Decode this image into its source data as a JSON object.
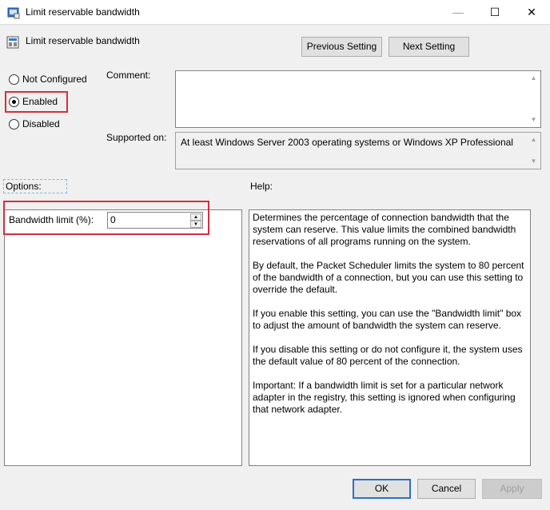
{
  "window": {
    "title": "Limit reservable bandwidth",
    "minimize_glyph": "—",
    "maximize_glyph": "☐",
    "close_glyph": "✕"
  },
  "header": {
    "setting_name": "Limit reservable bandwidth",
    "previous_label": "Previous Setting",
    "next_label": "Next Setting"
  },
  "state": {
    "not_configured_label": "Not Configured",
    "enabled_label": "Enabled",
    "disabled_label": "Disabled",
    "selected": "enabled"
  },
  "comment": {
    "label": "Comment:",
    "value": ""
  },
  "supported": {
    "label": "Supported on:",
    "value": "At least Windows Server 2003 operating systems or Windows XP Professional"
  },
  "options": {
    "label": "Options:",
    "bandwidth_label": "Bandwidth limit (%):",
    "bandwidth_value": "0"
  },
  "help": {
    "label": "Help:",
    "paragraphs": [
      "Determines the percentage of connection bandwidth that the system can reserve. This value limits the combined bandwidth reservations of all programs running on the system.",
      "By default, the Packet Scheduler limits the system to 80 percent of the bandwidth of a connection, but you can use this setting to override the default.",
      "If you enable this setting, you can use the \"Bandwidth limit\" box to adjust the amount of bandwidth the system can reserve.",
      "If you disable this setting or do not configure it, the system uses the default value of 80 percent of the connection.",
      "Important: If a bandwidth limit is set for a particular network adapter in the registry, this setting is ignored when configuring that network adapter."
    ]
  },
  "footer": {
    "ok_label": "OK",
    "cancel_label": "Cancel",
    "apply_label": "Apply"
  },
  "colors": {
    "highlight_box": "#d0303f",
    "default_button": "#2a6fc9"
  }
}
